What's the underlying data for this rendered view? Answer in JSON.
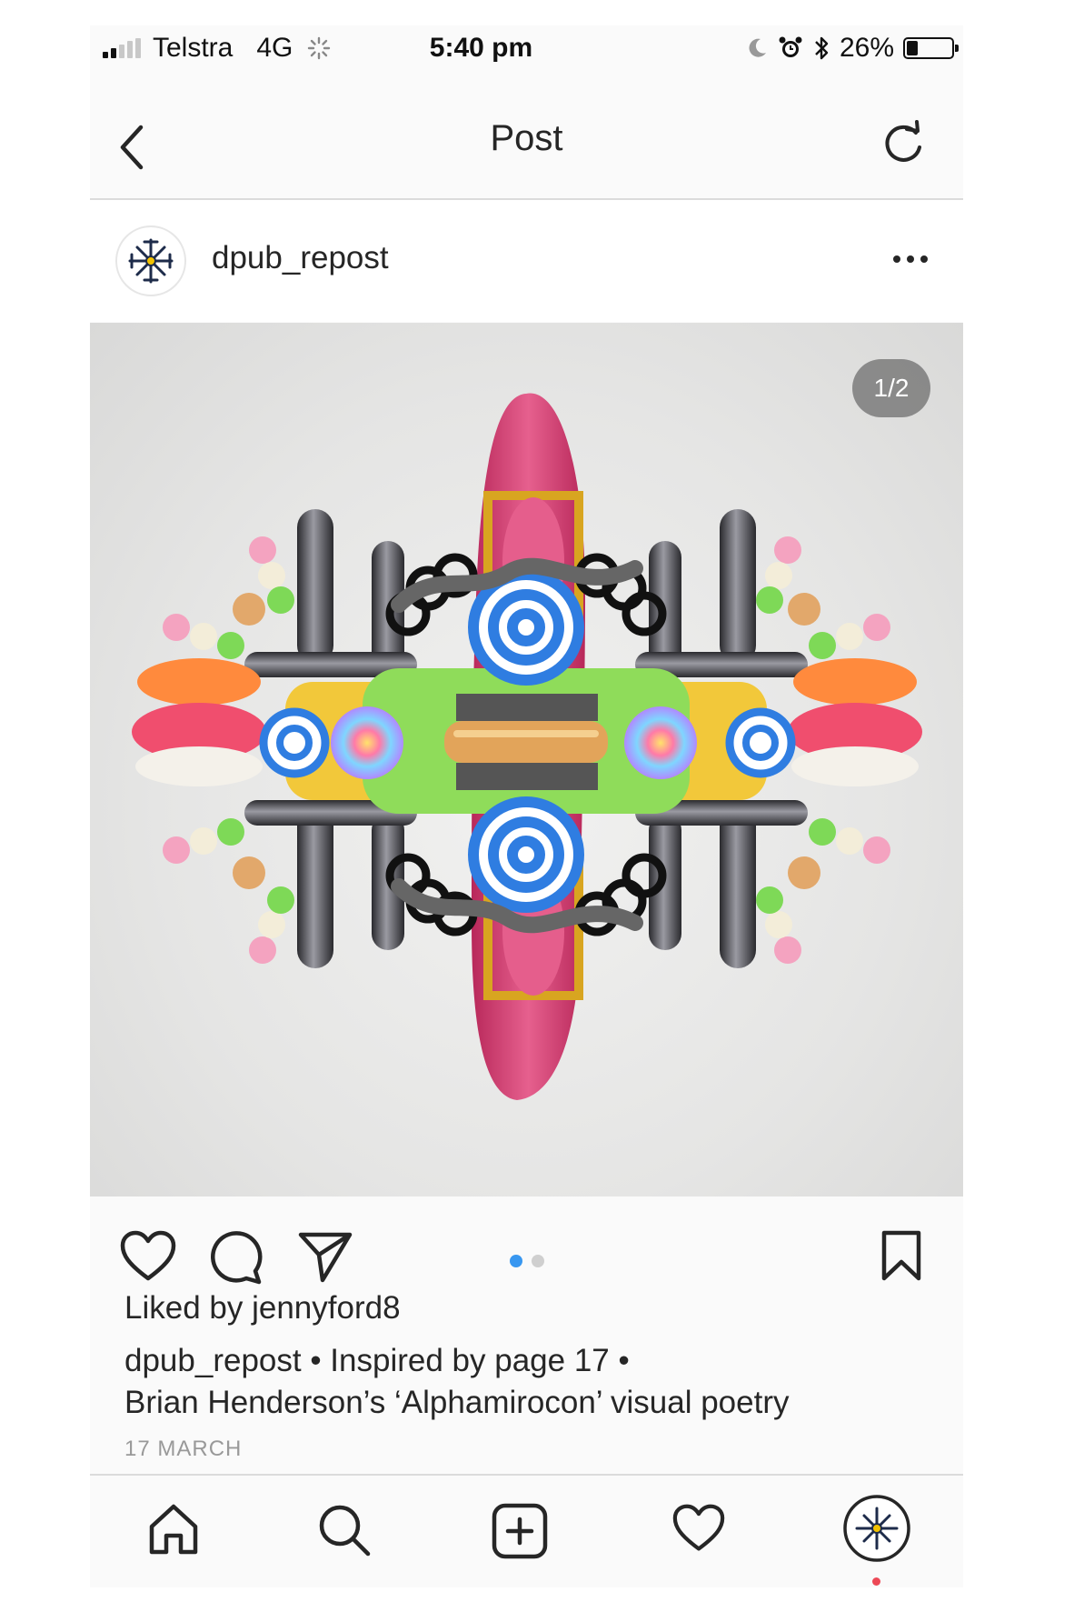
{
  "status_bar": {
    "carrier": "Telstra",
    "network": "4G",
    "time": "5:40 pm",
    "battery": "26%",
    "battery_level": 0.26,
    "icons": [
      "signal-icon",
      "activity-spinner-icon",
      "moon-icon",
      "alarm-icon",
      "bluetooth-icon",
      "battery-icon"
    ]
  },
  "nav": {
    "title": "Post",
    "back_icon": "chevron-left-icon",
    "refresh_icon": "refresh-icon"
  },
  "post": {
    "username": "dpub_repost",
    "more_icon": "ellipsis-icon",
    "page_counter": "1/2",
    "carousel_index": 1,
    "carousel_total": 2,
    "liked_by_prefix": "Liked by ",
    "liked_by_user": "jennyford8",
    "caption_username": "dpub_repost",
    "caption_line1": " • Inspired by page 17 •",
    "caption_line2": "Brian Henderson’s ‘Alphamirocon’ visual poetry",
    "date": "17 MARCH"
  },
  "actions": {
    "icons": [
      "heart-icon",
      "comment-icon",
      "share-icon",
      "bookmark-icon"
    ]
  },
  "tab_bar": {
    "icons": [
      "home-icon",
      "search-icon",
      "add-post-icon",
      "activity-heart-icon",
      "profile-avatar"
    ]
  },
  "colors": {
    "accent_blue": "#3897f0",
    "notification_red": "#ed4956",
    "text": "#262626",
    "muted": "#999999"
  }
}
